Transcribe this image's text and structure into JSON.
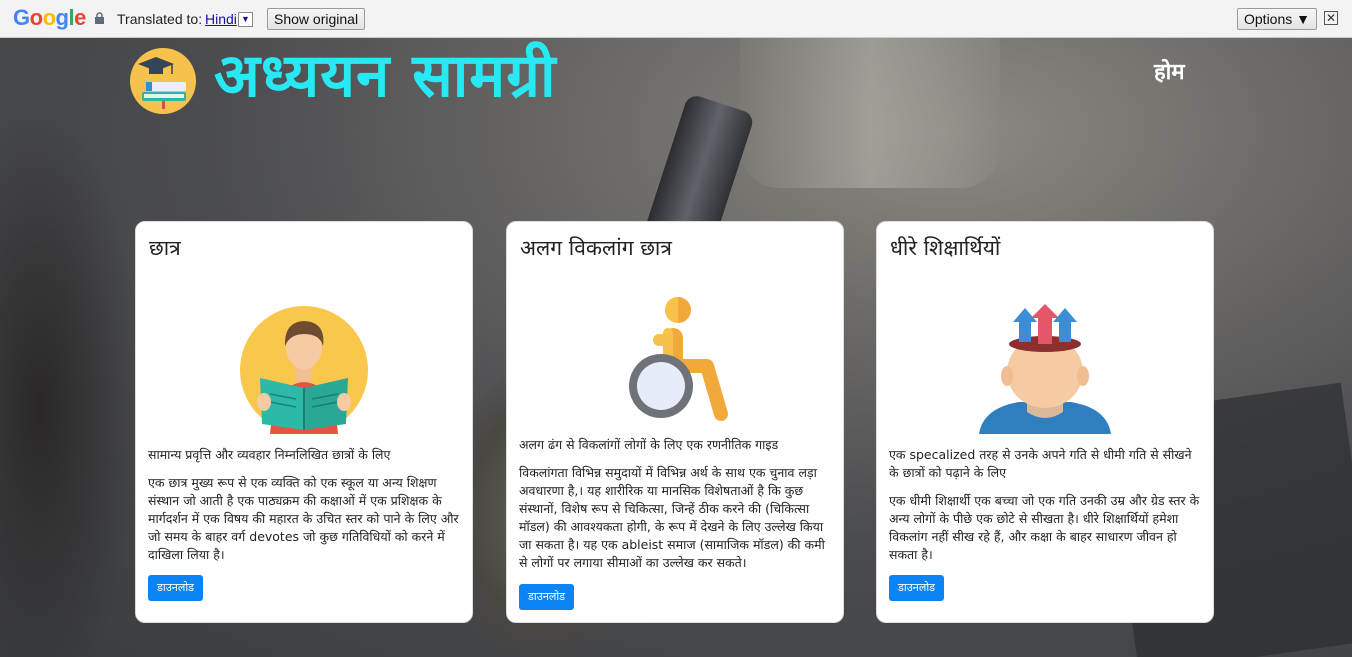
{
  "translate_bar": {
    "logo": "Google",
    "translated_to": "Translated to:",
    "language": "Hindi",
    "show_original": "Show original",
    "options": "Options ▼",
    "close": "✕"
  },
  "site": {
    "title": "अध्ययन सामग्री",
    "nav_home": "होम"
  },
  "cards": [
    {
      "title": "छात्र",
      "subtitle": "सामान्य प्रवृत्ति और व्यवहार निम्नलिखित छात्रों के लिए",
      "body": "एक छात्र मुख्य रूप से एक व्यक्ति को एक स्कूल या अन्य शिक्षण संस्थान जो आती है एक पाठ्यक्रम की कक्षाओं में एक प्रशिक्षक के मार्गदर्शन में एक विषय की महारत के उचित स्तर को पाने के लिए और जो समय के बाहर वर्ग devotes जो कुछ गतिविधियों को करने में दाखिला लिया है।",
      "button": "डाउनलोड",
      "icon": "student-reading-icon"
    },
    {
      "title": "अलग विकलांग छात्र",
      "subtitle": "अलग ढंग से विकलांगों लोगों के लिए एक रणनीतिक गाइड",
      "body": "विकलांगता विभिन्न समुदायों में विभिन्न अर्थ के साथ एक चुनाव लड़ा अवधारणा है,। यह शारीरिक या मानसिक विशेषताओं है कि कुछ संस्थानों, विशेष रूप से चिकित्सा, जिन्हें ठीक करने की (चिकित्सा मॉडल) की आवश्यकता होगी, के रूप में देखने के लिए उल्लेख किया जा सकता है। यह एक ableist समाज (सामाजिक मॉडल) की कमी से लोगों पर लगाया सीमाओं का उल्लेख कर सकते।",
      "button": "डाउनलोड",
      "icon": "wheelchair-icon"
    },
    {
      "title": "धीरे शिक्षार्थियों",
      "subtitle": "एक specalized तरह से उनके अपने गति से धीमी गति से सीखने के छात्रों को पढ़ाने के लिए",
      "body": "एक धीमी शिक्षार्थी एक बच्चा जो एक गति उनकी उम्र और ग्रेड स्तर के अन्य लोगों के पीछे एक छोटे से सीखता है। धीरे शिक्षार्थियों हमेशा विकलांग नहीं सीख रहे हैं, और कक्षा के बाहर साधारण जीवन हो सकता है।",
      "button": "डाउनलोड",
      "icon": "head-growth-arrows-icon"
    }
  ],
  "colors": {
    "title_cyan": "#27e9f4",
    "button_blue": "#0d84f5"
  }
}
